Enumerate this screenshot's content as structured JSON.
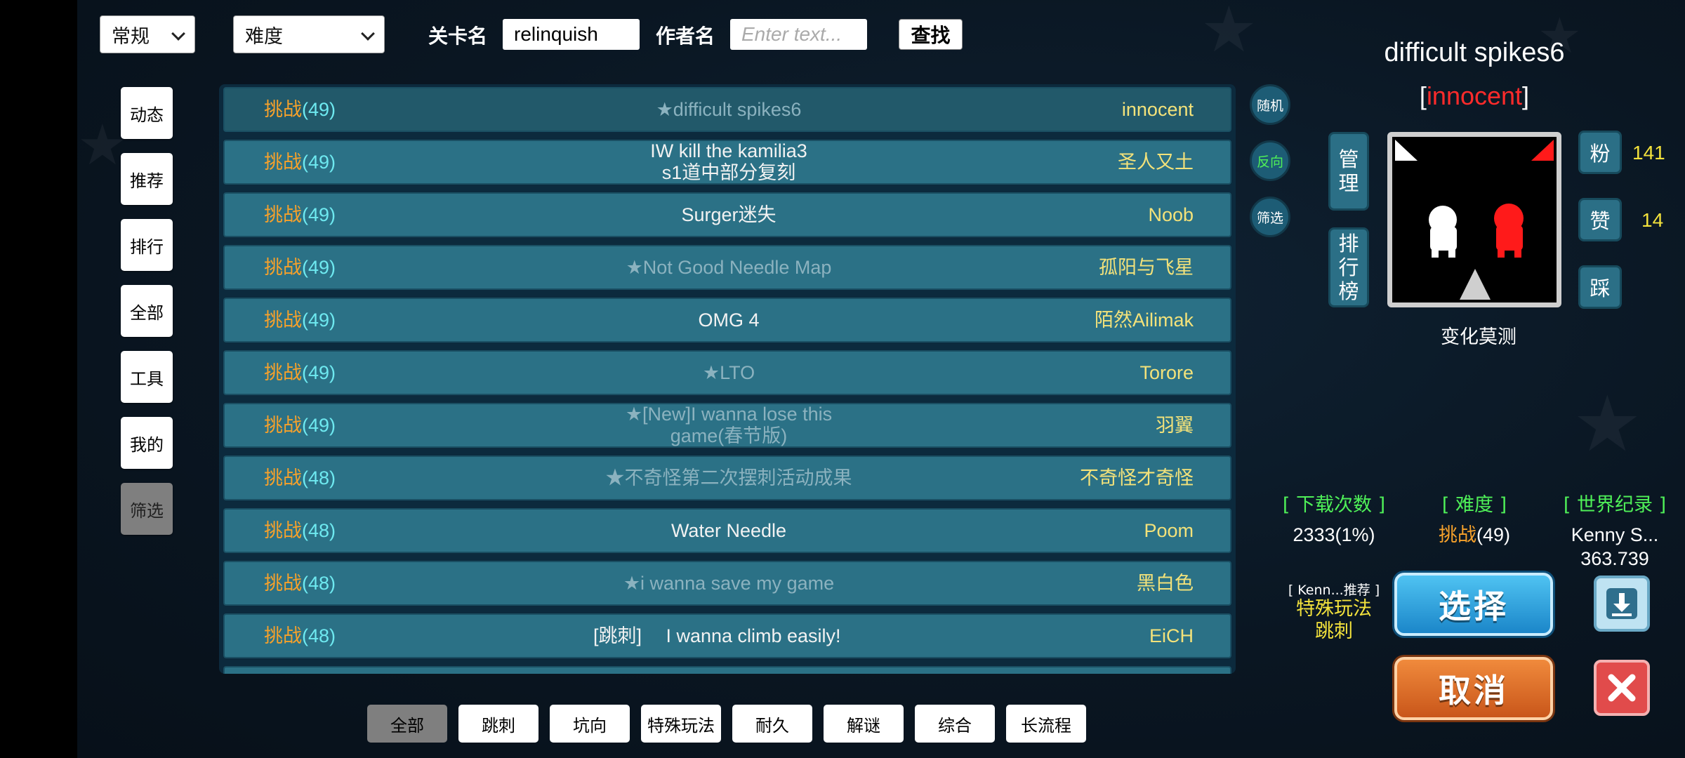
{
  "top_bar": {
    "category_dropdown": "常规",
    "difficulty_dropdown": "难度",
    "level_name_label": "关卡名",
    "level_name_value": "relinquish",
    "author_label": "作者名",
    "author_placeholder": "Enter text...",
    "search_button": "查找"
  },
  "left_nav": [
    {
      "label": "动态",
      "selected": false
    },
    {
      "label": "推荐",
      "selected": false
    },
    {
      "label": "排行",
      "selected": false
    },
    {
      "label": "全部",
      "selected": false
    },
    {
      "label": "工具",
      "selected": false
    },
    {
      "label": "我的",
      "selected": false
    },
    {
      "label": "筛选",
      "selected": true
    }
  ],
  "levels": [
    {
      "difficulty": "挑战",
      "level": "(49)",
      "title": "★difficult spikes6",
      "title2": "",
      "tag": "",
      "author": "innocent",
      "dim": true,
      "selected": true
    },
    {
      "difficulty": "挑战",
      "level": "(49)",
      "title": "IW kill the kamilia3",
      "title2": "s1道中部分复刻",
      "tag": "",
      "author": "圣人又土",
      "dim": false,
      "selected": false
    },
    {
      "difficulty": "挑战",
      "level": "(49)",
      "title": "Surger迷失",
      "title2": "",
      "tag": "",
      "author": "Noob",
      "dim": false,
      "selected": false
    },
    {
      "difficulty": "挑战",
      "level": "(49)",
      "title": "★Not Good Needle Map",
      "title2": "",
      "tag": "",
      "author": "孤阳与飞星",
      "dim": true,
      "selected": false
    },
    {
      "difficulty": "挑战",
      "level": "(49)",
      "title": "OMG 4",
      "title2": "",
      "tag": "",
      "author": "陌然Ailimak",
      "dim": false,
      "selected": false
    },
    {
      "difficulty": "挑战",
      "level": "(49)",
      "title": "★LTO",
      "title2": "",
      "tag": "",
      "author": "Torore",
      "dim": true,
      "selected": false
    },
    {
      "difficulty": "挑战",
      "level": "(49)",
      "title": "★[New]I wanna lose this",
      "title2": "game(春节版)",
      "tag": "",
      "author": "羽翼",
      "dim": true,
      "selected": false
    },
    {
      "difficulty": "挑战",
      "level": "(48)",
      "title": "★不奇怪第二次摆刺活动成果",
      "title2": "",
      "tag": "",
      "author": "不奇怪才奇怪",
      "dim": true,
      "selected": false
    },
    {
      "difficulty": "挑战",
      "level": "(48)",
      "title": "Water Needle",
      "title2": "",
      "tag": "",
      "author": "Poom",
      "dim": false,
      "selected": false
    },
    {
      "difficulty": "挑战",
      "level": "(48)",
      "title": "★i wanna save my game",
      "title2": "",
      "tag": "",
      "author": "黑白色",
      "dim": true,
      "selected": false
    },
    {
      "difficulty": "挑战",
      "level": "(48)",
      "title": "I wanna climb easily!",
      "title2": "",
      "tag": "[跳刺]",
      "author": "EiCH",
      "dim": false,
      "selected": false
    }
  ],
  "side_buttons": [
    "随机",
    "反向",
    "筛选"
  ],
  "colors": {
    "difficulty_name": "#f6a12b",
    "difficulty_num": "#6ee9f0",
    "author": "#f3e27a",
    "highlight_author": "#ff2b2b",
    "stat_header": "#4ff058",
    "reverse_button_text": "#4ff058"
  },
  "detail": {
    "title": "difficult spikes6",
    "author_bracket_open": "[",
    "author": "innocent",
    "author_bracket_close": "]",
    "manage_button": "管理",
    "ranking_button": "排行榜",
    "fans_button": "粉",
    "fans_count": "141",
    "like_button": "赞",
    "like_count": "14",
    "dislike_button": "踩",
    "category": "变化莫测",
    "stats": {
      "downloads_header": "[ 下载次数 ]",
      "downloads_value": "2333(1%)",
      "difficulty_header": "[ 难度 ]",
      "difficulty_name": "挑战",
      "difficulty_num": "(49)",
      "record_header": "[ 世界纪录 ]",
      "record_holder": "Kenny S...",
      "record_time": "363.739"
    },
    "recommend_label": "[ Kenn...推荐 ]",
    "recommend_tag1": "特殊玩法",
    "recommend_tag2": "跳刺",
    "select_button": "选择",
    "cancel_button": "取消",
    "download_icon": "download-icon",
    "close_icon": "close-icon"
  },
  "bottom_tabs": [
    {
      "label": "全部",
      "selected": true
    },
    {
      "label": "跳刺",
      "selected": false
    },
    {
      "label": "坑向",
      "selected": false
    },
    {
      "label": "特殊玩法",
      "selected": false
    },
    {
      "label": "耐久",
      "selected": false
    },
    {
      "label": "解谜",
      "selected": false
    },
    {
      "label": "综合",
      "selected": false
    },
    {
      "label": "长流程",
      "selected": false
    }
  ]
}
